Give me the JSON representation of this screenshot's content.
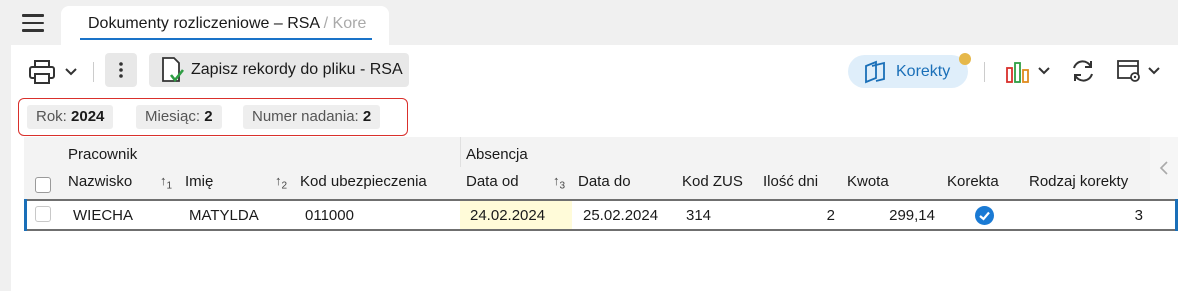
{
  "tab": {
    "title": "Dokumenty rozliczeniowe – RSA",
    "suffix": " / Kore"
  },
  "toolbar": {
    "save_label": "Zapisz rekordy do pliku - RSA",
    "korekty_label": "Korekty"
  },
  "filters": [
    {
      "key": "Rok: ",
      "value": "2024"
    },
    {
      "key": "Miesiąc: ",
      "value": "2"
    },
    {
      "key": "Numer nadania: ",
      "value": "2"
    }
  ],
  "grid": {
    "groups": {
      "pracownik": "Pracownik",
      "absencja": "Absencja"
    },
    "columns": {
      "nazwisko": "Nazwisko",
      "imie": "Imię",
      "kod_ubezpieczenia": "Kod ubezpieczenia",
      "data_od": "Data od",
      "data_do": "Data do",
      "kod_zus": "Kod ZUS",
      "ilosc_dni": "Ilość dni",
      "kwota": "Kwota",
      "korekta": "Korekta",
      "rodzaj_korekty": "Rodzaj korekty"
    },
    "sort": {
      "nazwisko": "1",
      "imie": "2",
      "data_od": "3"
    },
    "rows": [
      {
        "nazwisko": "WIECHA",
        "imie": "MATYLDA",
        "kod_ubezpieczenia": "011000",
        "data_od": "24.02.2024",
        "data_do": "25.02.2024",
        "kod_zus": "314",
        "ilosc_dni": "2",
        "kwota": "299,14",
        "korekta": true,
        "rodzaj_korekty": "3"
      }
    ]
  },
  "colors": {
    "accent": "#1a6fb8",
    "filter_border": "#d9302c",
    "badge": "#e6b84a",
    "highlight": "#fffbd9"
  }
}
